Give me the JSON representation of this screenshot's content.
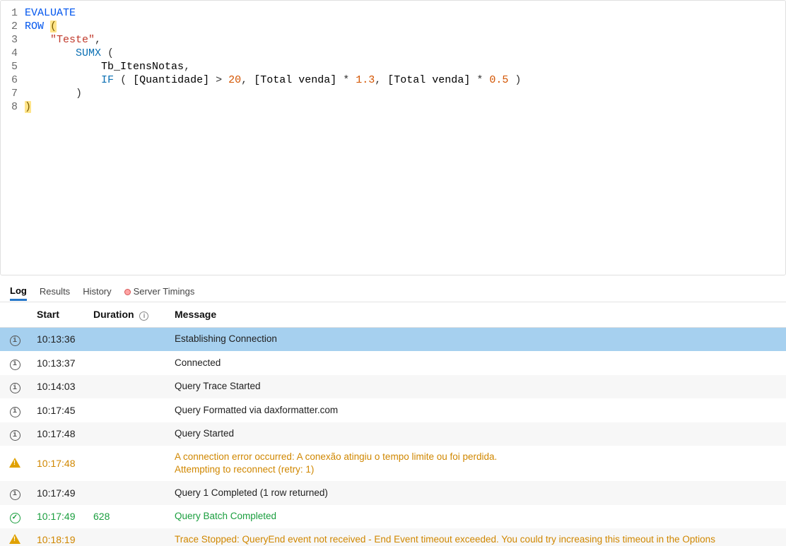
{
  "editor": {
    "lineCount": 8,
    "lines": [
      [
        {
          "cls": "tok-kw",
          "t": "EVALUATE"
        }
      ],
      [
        {
          "cls": "tok-kw",
          "t": "ROW"
        },
        {
          "cls": "",
          "t": " "
        },
        {
          "cls": "hl-paren",
          "t": "("
        }
      ],
      [
        {
          "cls": "",
          "t": "    "
        },
        {
          "cls": "tok-str",
          "t": "\"Teste\""
        },
        {
          "cls": "tok-pun",
          "t": ","
        }
      ],
      [
        {
          "cls": "",
          "t": "        "
        },
        {
          "cls": "tok-fn",
          "t": "SUMX"
        },
        {
          "cls": "",
          "t": " "
        },
        {
          "cls": "tok-pun",
          "t": "("
        }
      ],
      [
        {
          "cls": "",
          "t": "            "
        },
        {
          "cls": "tok-id",
          "t": "Tb_ItensNotas"
        },
        {
          "cls": "tok-pun",
          "t": ","
        }
      ],
      [
        {
          "cls": "",
          "t": "            "
        },
        {
          "cls": "tok-fn",
          "t": "IF"
        },
        {
          "cls": "",
          "t": " "
        },
        {
          "cls": "tok-pun",
          "t": "( "
        },
        {
          "cls": "tok-id",
          "t": "[Quantidade]"
        },
        {
          "cls": "",
          "t": " "
        },
        {
          "cls": "tok-pun",
          "t": ">"
        },
        {
          "cls": "",
          "t": " "
        },
        {
          "cls": "tok-num",
          "t": "20"
        },
        {
          "cls": "tok-pun",
          "t": ", "
        },
        {
          "cls": "tok-id",
          "t": "[Total venda]"
        },
        {
          "cls": "",
          "t": " "
        },
        {
          "cls": "tok-pun",
          "t": "*"
        },
        {
          "cls": "",
          "t": " "
        },
        {
          "cls": "tok-num",
          "t": "1.3"
        },
        {
          "cls": "tok-pun",
          "t": ", "
        },
        {
          "cls": "tok-id",
          "t": "[Total venda]"
        },
        {
          "cls": "",
          "t": " "
        },
        {
          "cls": "tok-pun",
          "t": "*"
        },
        {
          "cls": "",
          "t": " "
        },
        {
          "cls": "tok-num",
          "t": "0.5"
        },
        {
          "cls": "",
          "t": " "
        },
        {
          "cls": "tok-pun",
          "t": ")"
        }
      ],
      [
        {
          "cls": "",
          "t": "        "
        },
        {
          "cls": "tok-pun",
          "t": ")"
        }
      ],
      [
        {
          "cls": "hl-paren",
          "t": ")"
        }
      ]
    ]
  },
  "tabs": {
    "log": "Log",
    "results": "Results",
    "history": "History",
    "serverTimings": "Server Timings"
  },
  "headers": {
    "start": "Start",
    "duration": "Duration",
    "message": "Message"
  },
  "rows": [
    {
      "icon": "info",
      "start": "10:13:36",
      "dur": "",
      "msg": "Establishing Connection",
      "cls": "selected"
    },
    {
      "icon": "info",
      "start": "10:13:37",
      "dur": "",
      "msg": "Connected",
      "cls": ""
    },
    {
      "icon": "info",
      "start": "10:14:03",
      "dur": "",
      "msg": "Query Trace Started",
      "cls": ""
    },
    {
      "icon": "info",
      "start": "10:17:45",
      "dur": "",
      "msg": "Query Formatted via daxformatter.com",
      "cls": ""
    },
    {
      "icon": "info",
      "start": "10:17:48",
      "dur": "",
      "msg": "Query Started",
      "cls": ""
    },
    {
      "icon": "warn",
      "start": "10:17:48",
      "dur": "",
      "msg": "A connection error occurred: A conexão atingiu o tempo limite ou foi perdida.\nAttempting to reconnect (retry: 1)",
      "cls": "row-warn"
    },
    {
      "icon": "info",
      "start": "10:17:49",
      "dur": "",
      "msg": "Query 1 Completed (1 row returned)",
      "cls": ""
    },
    {
      "icon": "ok",
      "start": "10:17:49",
      "dur": "628",
      "msg": "Query Batch Completed",
      "cls": "row-ok"
    },
    {
      "icon": "warn",
      "start": "10:18:19",
      "dur": "",
      "msg": "Trace Stopped: QueryEnd event not received - End Event timeout exceeded. You could try increasing this timeout in the Options",
      "cls": "row-warn"
    }
  ]
}
